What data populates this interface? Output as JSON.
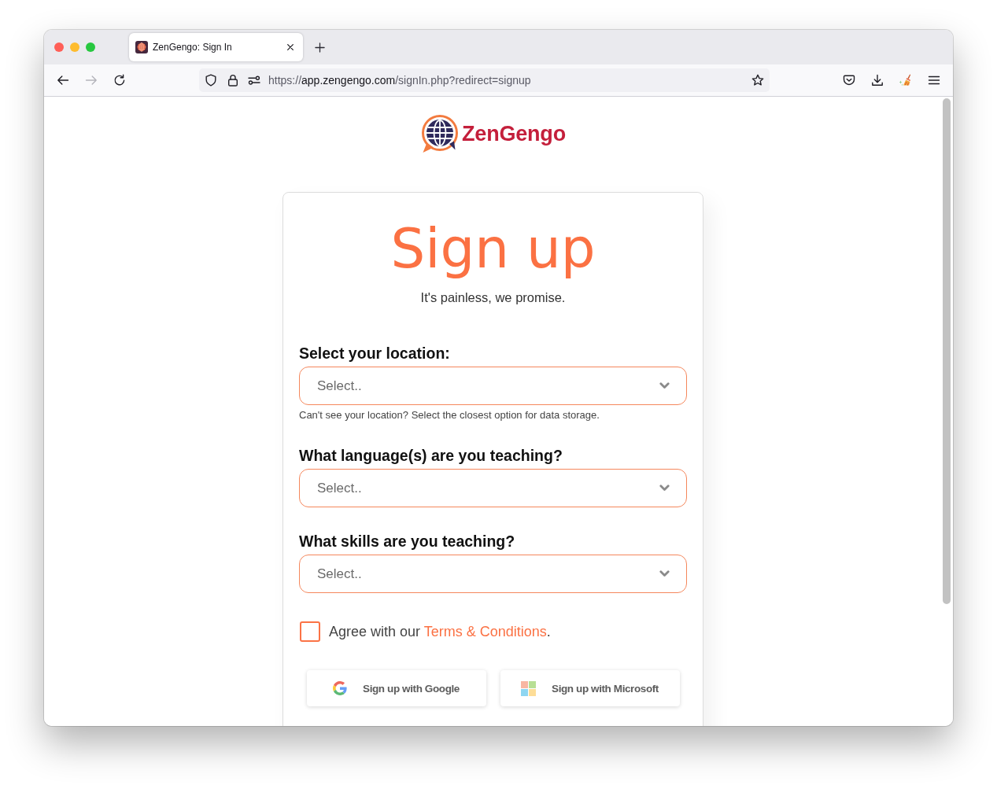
{
  "browser": {
    "tabs": [
      {
        "title": "ZenGengo: Sign In",
        "selected": true
      }
    ],
    "navigation": {
      "back_disabled": false,
      "forward_disabled": true
    },
    "url": {
      "scheme": "https://",
      "host": "app.zengengo.com",
      "path": "/signIn.php?redirect=signup"
    }
  },
  "logo": {
    "text": "ZenGengo"
  },
  "form": {
    "title": "Sign up",
    "subtitle": "It's painless, we promise.",
    "fields": [
      {
        "label": "Select your location:",
        "placeholder": "Select..",
        "help": "Can't see your location? Select the closest option for data storage."
      },
      {
        "label": "What language(s) are you teaching?",
        "placeholder": "Select.."
      },
      {
        "label": "What skills are you teaching?",
        "placeholder": "Select.."
      }
    ],
    "agree": {
      "checked": false,
      "text": "Agree with our",
      "link": "Terms & Conditions",
      "end": "."
    },
    "social_buttons": [
      {
        "kind": "google",
        "label": "Sign up with Google"
      },
      {
        "kind": "microsoft",
        "label": "Sign up with Microsoft"
      }
    ]
  }
}
